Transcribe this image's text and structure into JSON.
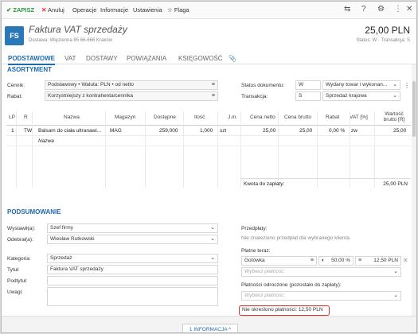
{
  "toolbar": {
    "save": "ZAPISZ",
    "cancel": "Anuluj",
    "menu": [
      "Operacje",
      "Informacje",
      "Ustawienia"
    ],
    "flag": "Flaga"
  },
  "header": {
    "avatar": "FS",
    "title": "Faktura VAT sprzedaży",
    "delivery": "Dostawa: Więzienna  85  66-666 Kraków",
    "amount": "25,00 PLN",
    "status": "Status: W  ·  Transakcja: S"
  },
  "tabs": [
    "PODSTAWOWE",
    "VAT",
    "DOSTAWY",
    "POWIĄZANIA",
    "KSIĘGOWOŚĆ"
  ],
  "assortment": {
    "title": "ASORTYMENT",
    "cennik_label": "Cennik:",
    "cennik_value": "Podstawowy • Waluta: PLN • od netto",
    "rabat_label": "Rabat:",
    "rabat_value": "Korzystniejszy z kontrahenta/cennika",
    "status_label": "Status dokumentu:",
    "status_code": "W",
    "status_value": "Wydany towar i wykonan...",
    "trans_label": "Transakcja:",
    "trans_code": "S",
    "trans_value": "Sprzedaż krajowa"
  },
  "table": {
    "headers": [
      "LP",
      "R",
      "Nazwa",
      "Magazyn",
      "Dostępne",
      "Ilość",
      "J.m.",
      "Cena netto",
      "Cena brutto",
      "Rabat",
      "VAT [%]",
      "Wartość brutto [R]"
    ],
    "rows": [
      [
        "1",
        "TW",
        "Balsam do ciała ultranawi...",
        "MAG",
        "259,000",
        "1,000",
        "szt",
        "25,00",
        "25,00",
        "0,00 %",
        "zw",
        "25,00"
      ]
    ],
    "new_row_placeholder": "Nazwa",
    "total_label": "Kwota do zapłaty:",
    "total_value": "25,00 PLN"
  },
  "summary": {
    "title": "PODSUMOWANIE",
    "wystawil_label": "Wystawił(a):",
    "wystawil_value": "Szef firmy",
    "odebral_label": "Odebrał(a):",
    "odebral_value": "Wiesław Rutkowski",
    "kategoria_label": "Kategoria:",
    "kategoria_value": "Sprzedaż",
    "tytul_label": "Tytuł:",
    "tytul_value": "Faktura VAT sprzedaży",
    "podtytul_label": "Podtytuł:",
    "uwagi_label": "Uwagi:",
    "przedplaty_label": "Przedpłaty:",
    "przedplaty_info": "Nie znaleziono przedpłat dla wybranego klienta.",
    "platne_label": "Płatne teraz:",
    "payment_method": "Gotówka",
    "payment_percent": "50,00 %",
    "payment_amount": "12,50 PLN",
    "payment_placeholder": "Wybierz płatność",
    "odroczone_label": "Płatności odroczone (pozostało do zapłaty):",
    "odroczone_placeholder": "Wybierz płatność",
    "warning": "Nie określono płatności: 12,50 PLN"
  },
  "footer": {
    "info": "1 INFORMACJA ^"
  }
}
